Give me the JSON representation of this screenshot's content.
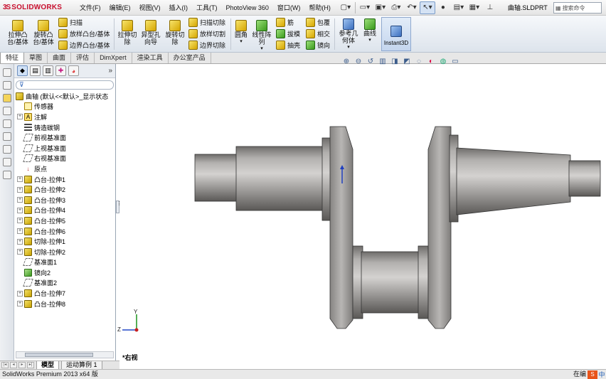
{
  "app": {
    "brand": "SOLIDWORKS",
    "menus": [
      "文件(F)",
      "编辑(E)",
      "视图(V)",
      "插入(I)",
      "工具(T)",
      "PhotoView 360",
      "窗口(W)",
      "帮助(H)"
    ],
    "filename": "曲轴.SLDPRT",
    "search_placeholder": "搜索命令"
  },
  "toolbar": {
    "extrude_boss": "拉伸凸台/基体",
    "revolve_boss": "旋转凸台/基体",
    "sweep": "扫描",
    "loft": "放样凸台/基体",
    "boundary_boss": "边界凸台/基体",
    "extrude_cut": "拉伸切除",
    "hole_wizard": "异型孔向导",
    "revolve_cut": "旋转切除",
    "swept_cut": "扫描切除",
    "lofted_cut": "放样切割",
    "boundary_cut": "边界切除",
    "fillet": "圆角",
    "linear_pattern": "线性阵列",
    "rib": "筋",
    "draft": "拔模",
    "shell": "抽壳",
    "wrap": "包覆",
    "intersect": "相交",
    "mirror": "镜向",
    "ref_geometry": "参考几何体",
    "curves": "曲线",
    "instant3d": "Instant3D"
  },
  "tabs": [
    "特征",
    "草图",
    "曲面",
    "评估",
    "DimXpert",
    "渲染工具",
    "办公室产品"
  ],
  "feature_tree": {
    "root": "曲轴 (默认<<默认>_显示状态",
    "items": [
      {
        "label": "传感器",
        "type": "sensor",
        "expandable": false
      },
      {
        "label": "注解",
        "type": "note",
        "expandable": true
      },
      {
        "label": "铸造碳钢",
        "type": "mat",
        "expandable": false
      },
      {
        "label": "前视基准面",
        "type": "plane",
        "expandable": false
      },
      {
        "label": "上视基准面",
        "type": "plane",
        "expandable": false
      },
      {
        "label": "右视基准面",
        "type": "plane",
        "expandable": false
      },
      {
        "label": "原点",
        "type": "origin",
        "expandable": false
      },
      {
        "label": "凸台-拉伸1",
        "type": "boss",
        "expandable": true
      },
      {
        "label": "凸台-拉伸2",
        "type": "boss",
        "expandable": true
      },
      {
        "label": "凸台-拉伸3",
        "type": "boss",
        "expandable": true
      },
      {
        "label": "凸台-拉伸4",
        "type": "boss",
        "expandable": true
      },
      {
        "label": "凸台-拉伸5",
        "type": "boss",
        "expandable": true
      },
      {
        "label": "凸台-拉伸6",
        "type": "boss",
        "expandable": true
      },
      {
        "label": "切除-拉伸1",
        "type": "cut",
        "expandable": true
      },
      {
        "label": "切除-拉伸2",
        "type": "cut",
        "expandable": true
      },
      {
        "label": "基准面1",
        "type": "plane",
        "expandable": false
      },
      {
        "label": "镜向2",
        "type": "mirror",
        "expandable": false
      },
      {
        "label": "基准面2",
        "type": "plane",
        "expandable": false
      },
      {
        "label": "凸台-拉伸7",
        "type": "boss",
        "expandable": true
      },
      {
        "label": "凸台-拉伸8",
        "type": "boss",
        "expandable": true
      }
    ]
  },
  "viewport": {
    "view_name": "*右视",
    "axis_y": "Y",
    "axis_z": "Z"
  },
  "bottom_tabs": [
    "模型",
    "运动算例 1"
  ],
  "status": {
    "text": "SolidWorks Premium 2013 x64 版",
    "right_text": "在编",
    "ime": "S",
    "lang": "中"
  }
}
